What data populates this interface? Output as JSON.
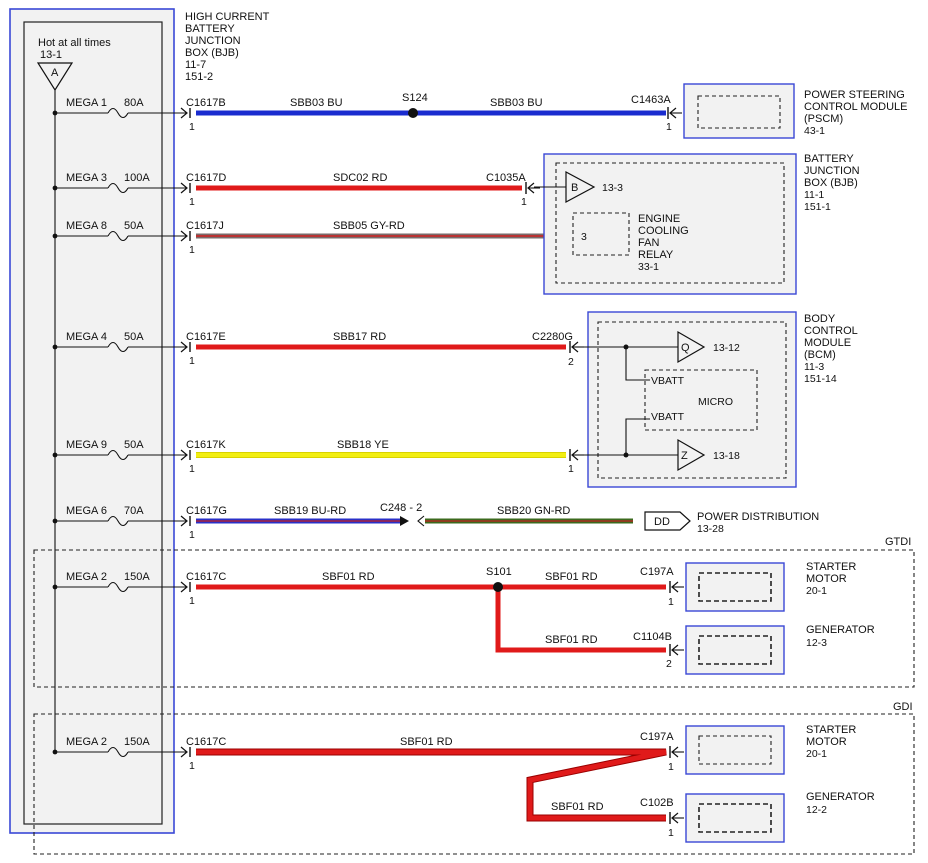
{
  "bjb_box": {
    "hot_text": "Hot at all times",
    "hot_ref": "13-1",
    "hot_symbol": "A",
    "title_lines": [
      "HIGH CURRENT",
      "BATTERY",
      "JUNCTION",
      "BOX (BJB)",
      "11-7",
      "151-2"
    ]
  },
  "fuses": [
    {
      "name": "MEGA 1",
      "rating": "80A"
    },
    {
      "name": "MEGA 3",
      "rating": "100A"
    },
    {
      "name": "MEGA 8",
      "rating": "50A"
    },
    {
      "name": "MEGA 4",
      "rating": "50A"
    },
    {
      "name": "MEGA 9",
      "rating": "50A"
    },
    {
      "name": "MEGA 6",
      "rating": "70A"
    },
    {
      "name": "MEGA 2",
      "rating": "150A"
    },
    {
      "name": "MEGA 2",
      "rating": "150A"
    }
  ],
  "source_connectors": [
    {
      "name": "C1617B",
      "pin": "1"
    },
    {
      "name": "C1617D",
      "pin": "1"
    },
    {
      "name": "C1617J",
      "pin": "1"
    },
    {
      "name": "C1617E",
      "pin": "1"
    },
    {
      "name": "C1617K",
      "pin": "1"
    },
    {
      "name": "C1617G",
      "pin": "1"
    },
    {
      "name": "C1617C",
      "pin": "1"
    },
    {
      "name": "C1617C",
      "pin": "1"
    }
  ],
  "circuits": [
    {
      "label": "SBB03   BU",
      "color": "#1a2ccf"
    },
    {
      "label": "SBB03   BU",
      "color": "#1a2ccf"
    },
    {
      "label": "SDC02   RD",
      "color": "#e01a1a"
    },
    {
      "label": "SBB05   GY-RD",
      "color": "#7a6a6a"
    },
    {
      "label": "SBB17   RD",
      "color": "#e01a1a"
    },
    {
      "label": "SBB18   YE",
      "color": "#f2ee12"
    },
    {
      "label": "SBB19   BU-RD",
      "color": "#2a30c8"
    },
    {
      "label": "SBB20   GN-RD",
      "color": "#3b6a1e"
    },
    {
      "label": "SBF01   RD",
      "color": "#e01a1a"
    },
    {
      "label": "SBF01   RD",
      "color": "#e01a1a"
    },
    {
      "label": "SBF01   RD",
      "color": "#e01a1a"
    },
    {
      "label": "SBF01   RD",
      "color": "#e01a1a"
    },
    {
      "label": "SBF01   RD",
      "color": "#e01a1a"
    }
  ],
  "splices": [
    {
      "name": "S124"
    },
    {
      "name": "C248  -  2"
    },
    {
      "name": "S101"
    }
  ],
  "dest_connectors": [
    {
      "name": "C1463A",
      "pin": "1"
    },
    {
      "name": "C1035A",
      "pin": "1"
    },
    {
      "name": "C2280G",
      "pin": "2"
    },
    {
      "name": "1"
    },
    {
      "name": "C197A",
      "pin": "1"
    },
    {
      "name": "C1104B",
      "pin": "2"
    },
    {
      "name": "C197A",
      "pin": "1"
    },
    {
      "name": "C102B",
      "pin": "1"
    }
  ],
  "components": {
    "pscm": {
      "lines": [
        "POWER STEERING",
        "CONTROL MODULE",
        "(PSCM)",
        "43-1"
      ]
    },
    "bjb": {
      "lines": [
        "BATTERY",
        "JUNCTION",
        "BOX (BJB)",
        "11-1",
        "151-1"
      ],
      "symbol": "B",
      "ref": "13-3"
    },
    "relay": {
      "pin": "3",
      "lines": [
        "ENGINE",
        "COOLING",
        "FAN",
        "RELAY",
        "33-1"
      ]
    },
    "bcm": {
      "lines": [
        "BODY",
        "CONTROL",
        "MODULE",
        "(BCM)",
        "11-3",
        "151-14"
      ],
      "q_symbol": "Q",
      "q_ref": "13-12",
      "z_symbol": "Z",
      "z_ref": "13-18",
      "vbatt1": "VBATT",
      "vbatt2": "VBATT",
      "micro": "MICRO"
    },
    "power_dist": {
      "symbol": "DD",
      "lines": [
        "POWER DISTRIBUTION",
        "13-28"
      ]
    },
    "starter_gtdi": {
      "lines": [
        "STARTER",
        "MOTOR",
        "20-1"
      ]
    },
    "generator_gtdi": {
      "lines": [
        "GENERATOR",
        "12-3"
      ]
    },
    "starter_gdi": {
      "lines": [
        "STARTER",
        "MOTOR",
        "20-1"
      ]
    },
    "generator_gdi": {
      "lines": [
        "GENERATOR",
        "12-2"
      ]
    }
  },
  "variants": {
    "gtdi": "GTDI",
    "gdi": "GDI"
  }
}
